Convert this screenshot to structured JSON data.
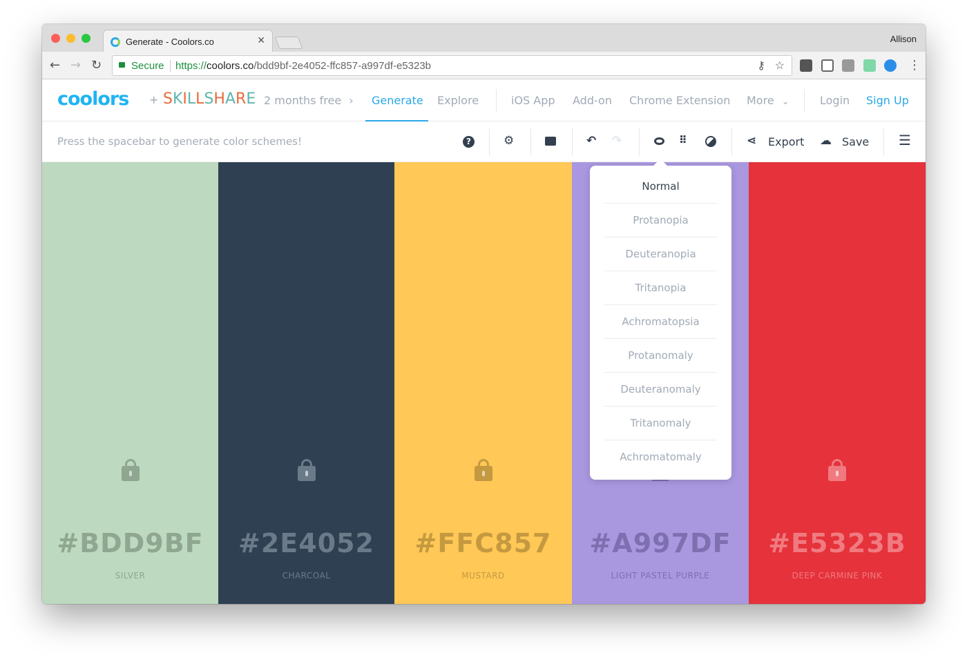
{
  "browser": {
    "tab_title": "Generate - Coolors.co",
    "profile": "Allison",
    "secure_label": "Secure",
    "url_scheme": "https://",
    "url_host": "coolors.co",
    "url_path": "/bdd9bf-2e4052-ffc857-a997df-e5323b"
  },
  "nav": {
    "logo": "coolors",
    "plus": "+",
    "partner": [
      "S",
      "K",
      "I",
      "L",
      "L",
      "S",
      "H",
      "A",
      "R",
      "E"
    ],
    "promo": "2 months free",
    "promo_arrow": "›",
    "links": [
      "Generate",
      "Explore",
      "iOS App",
      "Add-on",
      "Chrome Extension",
      "More"
    ],
    "more_caret": "⌄",
    "login": "Login",
    "signup": "Sign Up"
  },
  "toolbar": {
    "hint": "Press the spacebar to generate color schemes!",
    "export": "Export",
    "save": "Save",
    "icons": [
      "help-icon",
      "gear-icon",
      "camera-icon",
      "undo-icon",
      "redo-icon",
      "eye-icon",
      "grid-icon",
      "contrast-icon",
      "share-icon",
      "cloud-upload-icon",
      "menu-icon"
    ]
  },
  "palette": [
    {
      "hex": "#BDD9BF",
      "name": "SILVER",
      "color": "#bdd9bf",
      "fg": "#8fa691",
      "locked": false
    },
    {
      "hex": "#2E4052",
      "name": "CHARCOAL",
      "color": "#2e4052",
      "fg": "#6b7a89",
      "locked": false
    },
    {
      "hex": "#FFC857",
      "name": "MUSTARD",
      "color": "#ffc857",
      "fg": "#c4993f",
      "locked": false
    },
    {
      "hex": "#A997DF",
      "name": "LIGHT PASTEL PURPLE",
      "color": "#a997df",
      "fg": "#7e6fb0",
      "locked": false
    },
    {
      "hex": "#E5323B",
      "name": "DEEP CARMINE PINK",
      "color": "#e5323b",
      "fg": "#f07a80",
      "locked": false
    }
  ],
  "vision_menu": {
    "selected": "Normal",
    "items": [
      "Normal",
      "Protanopia",
      "Deuteranopia",
      "Tritanopia",
      "Achromatopsia",
      "Protanomaly",
      "Deuteranomaly",
      "Tritanomaly",
      "Achromatomaly"
    ]
  }
}
